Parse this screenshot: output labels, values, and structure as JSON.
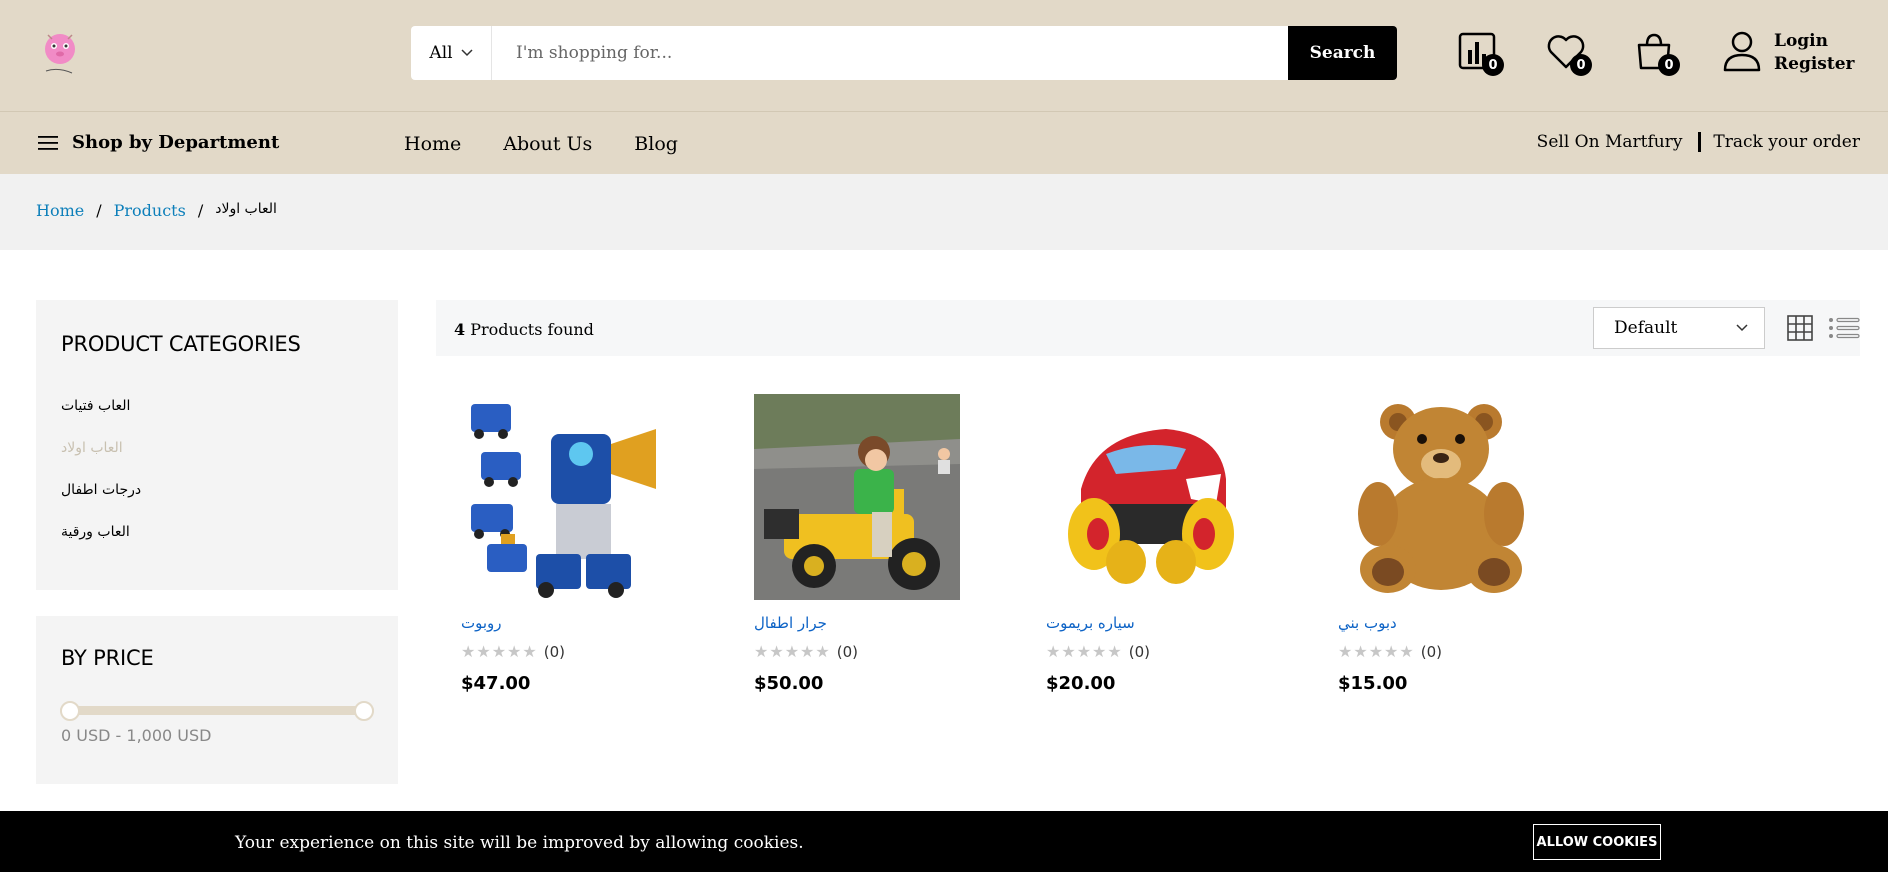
{
  "header": {
    "search_category": "All",
    "search_placeholder": "I'm shopping for...",
    "search_button": "Search",
    "compare_count": "0",
    "wishlist_count": "0",
    "cart_count": "0",
    "login": "Login",
    "register": "Register"
  },
  "nav": {
    "department": "Shop by Department",
    "links": [
      "Home",
      "About Us",
      "Blog"
    ],
    "sell": "Sell On Martfury",
    "track": "Track your order"
  },
  "breadcrumb": [
    "Home",
    "Products",
    "العاب اولاد"
  ],
  "sidebar": {
    "categories_title": "PRODUCT CATEGORIES",
    "categories": [
      "العاب فتيات",
      "العاب اولاد",
      "درجات اطفال",
      "العاب ورقية"
    ],
    "price_title": "BY PRICE",
    "price_range": "0 USD - 1,000 USD",
    "price_min_fraction": 0,
    "price_max_fraction": 1
  },
  "toolbar": {
    "found_count": "4",
    "found_label": "Products found",
    "sort": "Default"
  },
  "products": [
    {
      "name": "روبوت",
      "rating": "(0)",
      "price": "$47.00",
      "image": "robot-toy"
    },
    {
      "name": "جرار اطفال",
      "rating": "(0)",
      "price": "$50.00",
      "image": "kids-tractor"
    },
    {
      "name": "سياره بريموت",
      "rating": "(0)",
      "price": "$20.00",
      "image": "rc-car"
    },
    {
      "name": "دبوب بني",
      "rating": "(0)",
      "price": "$15.00",
      "image": "teddy-bear"
    }
  ],
  "cookie": {
    "text": "Your experience on this site will be improved by allowing cookies.",
    "button": "ALLOW COOKIES"
  }
}
